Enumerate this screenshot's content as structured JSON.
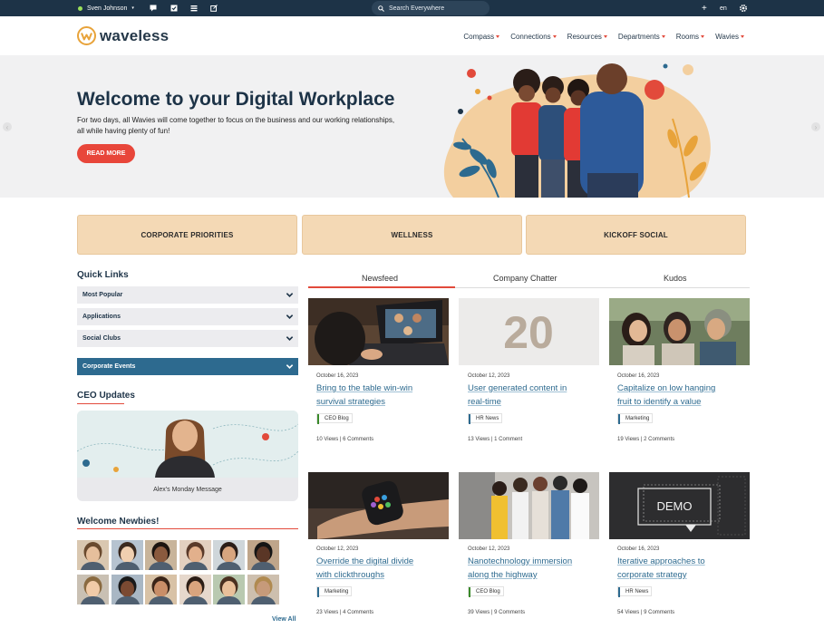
{
  "topbar": {
    "user_name": "Sven Johnson",
    "search_placeholder": "Search Everywhere",
    "lang": "en"
  },
  "header": {
    "logo_text": "waveless",
    "nav": [
      "Compass",
      "Connections",
      "Resources",
      "Departments",
      "Rooms",
      "Wavies"
    ]
  },
  "hero": {
    "title": "Welcome to your Digital Workplace",
    "description": "For two days, all Wavies will come together to focus on the business and our working relationships, all while having plenty of fun!",
    "button": "READ MORE"
  },
  "highlights": [
    "CORPORATE PRIORITIES",
    "WELLNESS",
    "KICKOFF SOCIAL"
  ],
  "quick_links": {
    "title": "Quick Links",
    "items": [
      "Most Popular",
      "Applications",
      "Social Clubs",
      "Corporate Events"
    ]
  },
  "ceo": {
    "title": "CEO Updates",
    "caption": "Alex's Monday Message"
  },
  "newbies": {
    "title": "Welcome Newbies!",
    "view_all": "View All"
  },
  "tabs": [
    "Newsfeed",
    "Company Chatter",
    "Kudos"
  ],
  "colors": {
    "accent": "#e24a3b",
    "navy": "#1d3347",
    "link": "#2d6a8f",
    "peach": "#f4d9b5",
    "tag_green": "#3a8a2a",
    "tag_blue": "#2d6a8f"
  },
  "cards": [
    {
      "date": "October 16, 2023",
      "title1": "Bring to the table win-win",
      "title2": "survival strategies",
      "tag": "CEO Blog",
      "tag_color": "green",
      "stats": "10 Views | 6 Comments"
    },
    {
      "date": "October 12, 2023",
      "title1": "User generated content in",
      "title2": "real-time",
      "tag": "HR News",
      "tag_color": "blue",
      "stats": "13 Views | 1 Comment"
    },
    {
      "date": "October 16, 2023",
      "title1": "Capitalize on low hanging",
      "title2": "fruit to identify a value",
      "tag": "Marketing",
      "tag_color": "blue",
      "stats": "19 Views | 2 Comments"
    },
    {
      "date": "October 12, 2023",
      "title1": "Override the digital divide",
      "title2": "with  clickthroughs",
      "tag": "Marketing",
      "tag_color": "blue",
      "stats": "23 Views | 4 Comments"
    },
    {
      "date": "October 12, 2023",
      "title1": "Nanotechnology immersion",
      "title2": "along the highway",
      "tag": "CEO Blog",
      "tag_color": "green",
      "stats": "39 Views | 9 Comments"
    },
    {
      "date": "October 16, 2023",
      "title1": "Iterative approaches to",
      "title2": "corporate strategy",
      "tag": "HR News",
      "tag_color": "blue",
      "stats": "54 Views | 9 Comments"
    }
  ],
  "card_images": {
    "c2_text": "20",
    "c6_text": "DEMO"
  }
}
